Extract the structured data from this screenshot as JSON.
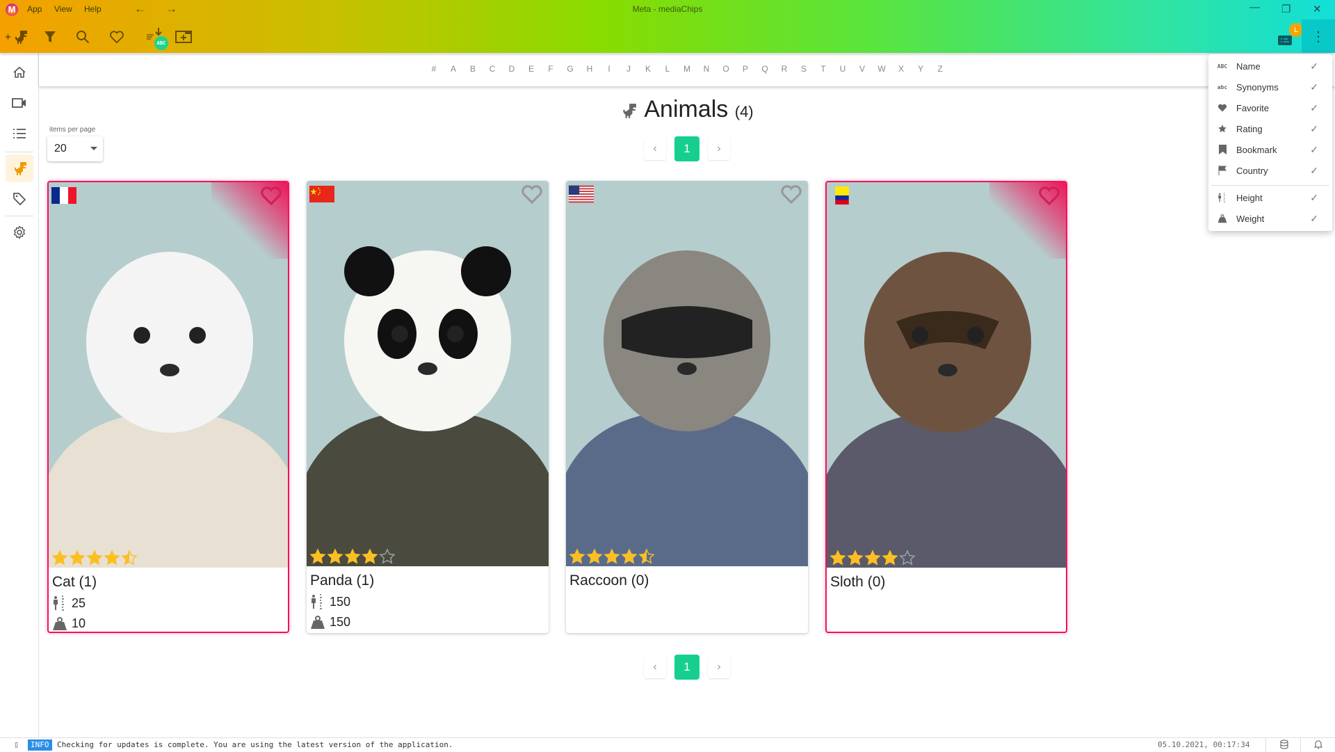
{
  "window": {
    "title": "Meta - mediaChips",
    "menu": [
      "App",
      "View",
      "Help"
    ],
    "logo_letter": "M",
    "controls": {
      "minimize": "—",
      "restore": "❐",
      "close": "✕"
    }
  },
  "toolbar": {
    "items": [
      "add-meta-icon",
      "filter-icon",
      "search-icon",
      "favorite-icon",
      "sort-abc-icon",
      "add-folder-icon"
    ],
    "sort_badge": "ABC",
    "notification_badge": "L",
    "more_icon": "⋮"
  },
  "sidebar": {
    "items": [
      {
        "name": "home",
        "active": false
      },
      {
        "name": "videos",
        "active": false
      },
      {
        "name": "lists",
        "active": false
      },
      {
        "name": "animals",
        "active": true
      },
      {
        "name": "tags",
        "active": false
      },
      {
        "name": "settings",
        "active": false
      }
    ]
  },
  "alphabet": [
    "#",
    "A",
    "B",
    "C",
    "D",
    "E",
    "F",
    "G",
    "H",
    "I",
    "J",
    "K",
    "L",
    "M",
    "N",
    "O",
    "P",
    "Q",
    "R",
    "S",
    "T",
    "U",
    "V",
    "W",
    "X",
    "Y",
    "Z"
  ],
  "page": {
    "title": "Animals",
    "count": "(4)",
    "items_per_page_label": "items per page",
    "items_per_page": "20"
  },
  "pagination": {
    "prev": "‹",
    "current": "1",
    "next": "›"
  },
  "cards": [
    {
      "name": "Cat (1)",
      "flag": "france",
      "favorite": true,
      "rating": 4.5,
      "height": "25",
      "weight": "10",
      "accent": "#ffffff"
    },
    {
      "name": "Panda (1)",
      "flag": "china",
      "favorite": false,
      "rating": 4,
      "height": "150",
      "weight": "150",
      "accent": "#111111"
    },
    {
      "name": "Raccoon (0)",
      "flag": "usa",
      "favorite": false,
      "rating": 4.5,
      "height": "",
      "weight": "",
      "accent": "#6b6b6b"
    },
    {
      "name": "Sloth (0)",
      "flag": "colombia",
      "favorite": true,
      "rating": 4,
      "height": "",
      "weight": "",
      "accent": "#6b4a30"
    }
  ],
  "columns_menu": {
    "items": [
      {
        "icon": "ABC",
        "label": "Name",
        "checked": true
      },
      {
        "icon": "abc",
        "label": "Synonyms",
        "checked": true
      },
      {
        "icon": "heart",
        "label": "Favorite",
        "checked": true
      },
      {
        "icon": "star",
        "label": "Rating",
        "checked": true
      },
      {
        "icon": "bookmark",
        "label": "Bookmark",
        "checked": true
      },
      {
        "icon": "flag",
        "label": "Country",
        "checked": true
      },
      {
        "icon": "height",
        "label": "Height",
        "checked": true
      },
      {
        "icon": "weight",
        "label": "Weight",
        "checked": true
      }
    ],
    "check_glyph": "✓"
  },
  "statusbar": {
    "level": "INFO",
    "message": "Checking for updates is complete. You are using the latest version of the application.",
    "datetime": "05.10.2021, 00:17:34"
  },
  "colors": {
    "accent_green": "#16cf8f",
    "favorite_pink": "#f0145a",
    "star_gold": "#fbbf24",
    "info_blue": "#2a8ee8"
  }
}
